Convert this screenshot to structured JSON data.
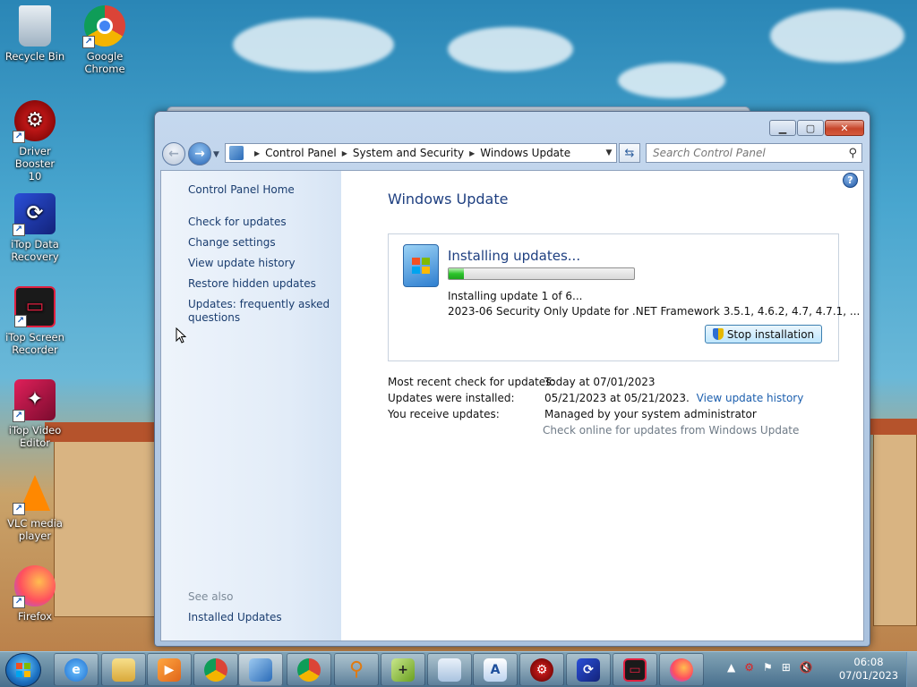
{
  "desktop": {
    "icons": [
      {
        "label": "Recycle Bin",
        "icon": "recycle-bin-icon"
      },
      {
        "label": "Google\nChrome",
        "icon": "chrome-icon"
      },
      {
        "label": "Driver Booster\n10",
        "icon": "driver-booster-icon"
      },
      {
        "label": "iTop Data\nRecovery",
        "icon": "itop-data-recovery-icon"
      },
      {
        "label": "iTop Screen\nRecorder",
        "icon": "itop-screen-recorder-icon"
      },
      {
        "label": "iTop Video\nEditor",
        "icon": "itop-video-editor-icon"
      },
      {
        "label": "VLC media\nplayer",
        "icon": "vlc-icon"
      },
      {
        "label": "Firefox",
        "icon": "firefox-icon"
      }
    ]
  },
  "window": {
    "breadcrumb": [
      "Control Panel",
      "System and Security",
      "Windows Update"
    ],
    "search_placeholder": "Search Control Panel",
    "sidebar": {
      "home": "Control Panel Home",
      "links": [
        "Check for updates",
        "Change settings",
        "View update history",
        "Restore hidden updates",
        "Updates: frequently asked questions"
      ],
      "see_also": "See also",
      "installed_updates": "Installed Updates"
    },
    "main": {
      "title": "Windows Update",
      "status_title": "Installing updates...",
      "progress_fraction": 0.08,
      "progress_line": "Installing update 1 of 6...",
      "update_name": "2023-06 Security Only Update for .NET Framework 3.5.1, 4.6.2, 4.7, 4.7.1, ...",
      "stop_button": "Stop installation",
      "info": {
        "recent_check_label": "Most recent check for updates:",
        "recent_check_value": "Today at 07/01/2023",
        "installed_label": "Updates were installed:",
        "installed_value": "05/21/2023 at 05/21/2023.",
        "installed_link": "View update history",
        "receive_label": "You receive updates:",
        "receive_value": "Managed by your system administrator",
        "online_check": "Check online for updates from Windows Update"
      }
    }
  },
  "taskbar": {
    "clock_time": "06:08",
    "clock_date": "07/01/2023"
  },
  "colors": {
    "title_blue": "#1e3f80",
    "link_blue": "#1c5fae",
    "progress_green": "#2bc42b"
  }
}
